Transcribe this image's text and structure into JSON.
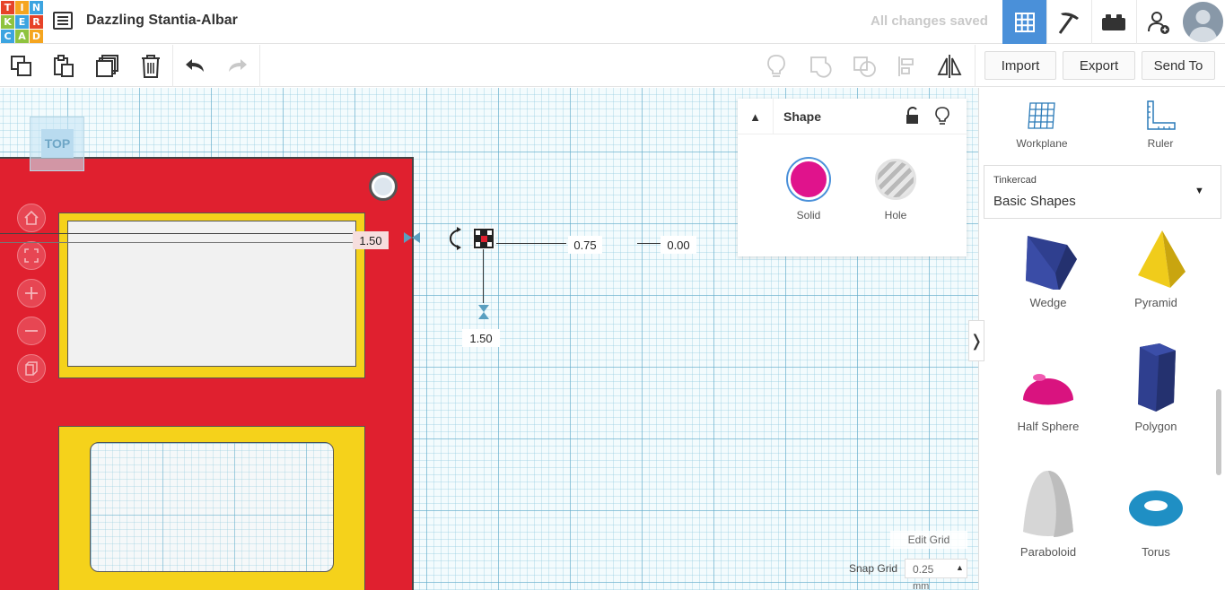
{
  "app": {
    "logo_letters": [
      "T",
      "I",
      "N",
      "K",
      "E",
      "R",
      "C",
      "A",
      "D"
    ],
    "logo_colors": [
      "#e64328",
      "#f5a51f",
      "#3ca4e0",
      "#8fc33f",
      "#3ca4e0",
      "#e64328",
      "#3ca4e0",
      "#8fc33f",
      "#f5a51f"
    ],
    "design_title": "Dazzling Stantia-Albar",
    "save_status": "All changes saved"
  },
  "topbar": {
    "icons": [
      "grid-view-icon",
      "pickaxe-icon",
      "bricks-icon",
      "add-user-icon",
      "avatar"
    ],
    "active_color": "#4a90d9"
  },
  "toolbar": {
    "import_label": "Import",
    "export_label": "Export",
    "send_to_label": "Send To"
  },
  "viewcube": {
    "label": "TOP"
  },
  "dimensions": {
    "left_value": "1.50",
    "right_value_1": "0.75",
    "right_value_2": "0.00",
    "bottom_value": "1.50"
  },
  "inspector": {
    "title": "Shape",
    "solid_label": "Solid",
    "hole_label": "Hole",
    "solid_color": "#e0138c"
  },
  "right_panel": {
    "workplane_label": "Workplane",
    "ruler_label": "Ruler",
    "library_caption": "Tinkercad",
    "library_value": "Basic Shapes",
    "shapes": [
      "Wedge",
      "Pyramid",
      "Half Sphere",
      "Polygon",
      "Paraboloid",
      "Torus"
    ]
  },
  "grid_controls": {
    "edit_grid_label": "Edit Grid",
    "snap_grid_label": "Snap Grid",
    "snap_value": "0.25",
    "snap_unit": "mm"
  },
  "colors": {
    "board_red": "#e0202f",
    "frame_yellow": "#f5d21b",
    "nav_red": "#e74653"
  }
}
